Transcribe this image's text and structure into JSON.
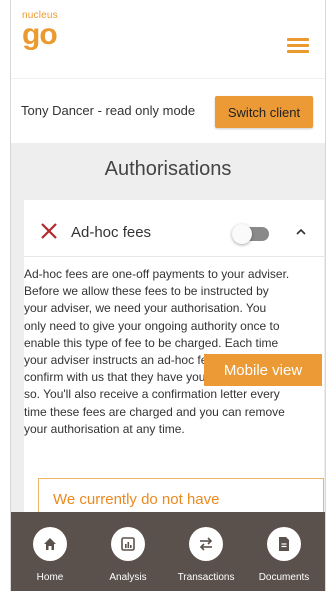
{
  "logo": {
    "small": "nucleus",
    "big": "go"
  },
  "client": {
    "name": "Tony Dancer - read only mode",
    "switch_label": "Switch client"
  },
  "page": {
    "title": "Authorisations"
  },
  "fee": {
    "label": "Ad-hoc fees",
    "enabled": false,
    "description_lines": [
      "Ad-hoc fees are one-off payments to your adviser.",
      "Before we allow these fees to be instructed by",
      "your adviser, we need your authorisation. You",
      "only need to give your ongoing authority once to",
      "enable this type of fee to be charged. Each time",
      "your adviser instructs an ad-hoc fee, we'll",
      "confirm with us that they have your approval to do",
      "so. You'll also receive a confirmation letter every",
      "time these fees are charged and you can remove",
      "your authorisation at any time."
    ],
    "notice": "We currently do not have"
  },
  "overlay": {
    "label": "Mobile view"
  },
  "nav": [
    {
      "label": "Home",
      "icon": "home-icon"
    },
    {
      "label": "Analysis",
      "icon": "analysis-icon"
    },
    {
      "label": "Transactions",
      "icon": "transactions-icon"
    },
    {
      "label": "Documents",
      "icon": "documents-icon"
    }
  ],
  "colors": {
    "accent": "#ec9a35",
    "nav_bg": "#5a514c",
    "x_red": "#b3262a"
  }
}
